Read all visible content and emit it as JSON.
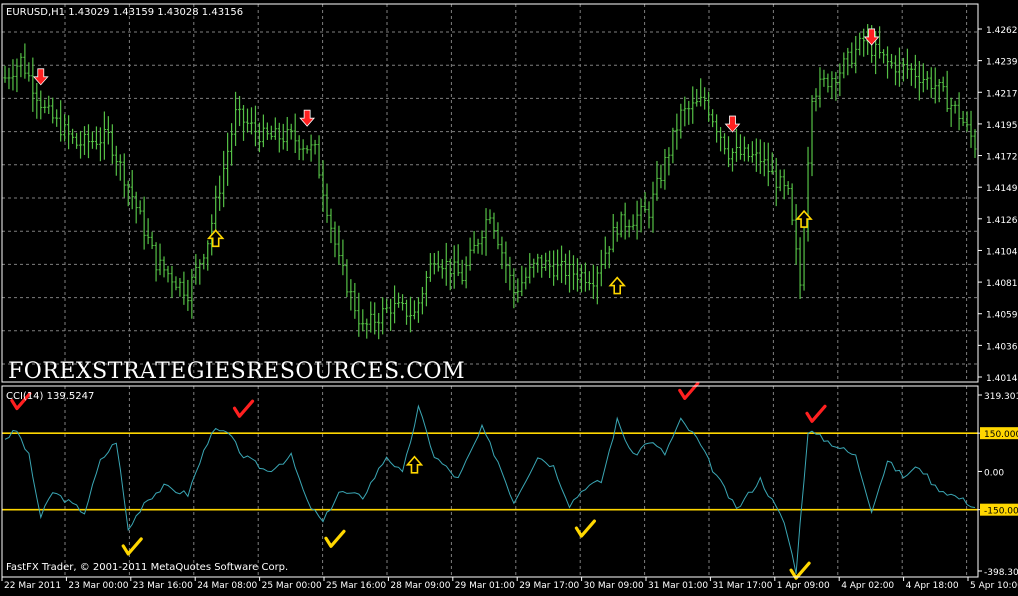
{
  "main_panel": {
    "header": "EURUSD,H1  1.43029 1.43159 1.43028 1.43156",
    "watermark": "FOREXSTRATEGIESRESOURCES.COM",
    "price_ticks": [
      "1.42620",
      "1.42399",
      "1.42170",
      "1.41950",
      "1.41720",
      "1.41490",
      "1.41260",
      "1.41040",
      "1.40815",
      "1.40590",
      "1.40365",
      "1.40140"
    ]
  },
  "indicator_panel": {
    "header": "CCI(14) 139.5247",
    "level_ticks": [
      "319.301",
      "150.000",
      "0.00",
      "-150.000",
      "-398.301"
    ]
  },
  "footer": {
    "copyright": "FastFX Trader, © 2001-2011 MetaQuotes Software Corp."
  },
  "time_axis": {
    "labels": [
      "22 Mar 2011",
      "23 Mar 00:00",
      "23 Mar 16:00",
      "24 Mar 08:00",
      "25 Mar 00:00",
      "25 Mar 16:00",
      "28 Mar 09:00",
      "29 Mar 01:00",
      "29 Mar 17:00",
      "30 Mar 09:00",
      "31 Mar 01:00",
      "31 Mar 17:00",
      "1 Apr 09:00",
      "4 Apr 02:00",
      "4 Apr 18:00",
      "5 Apr 10:00"
    ]
  },
  "colors": {
    "background": "#000000",
    "grid": "#7f7f7f",
    "bars": "#55c046",
    "cci_line": "#3aa6b4",
    "levels": "#ffd700",
    "sell_arrow": "#ff2020",
    "buy_arrow": "#ffd700",
    "frame": "#ffffff"
  },
  "chart_data": [
    {
      "type": "ohlc",
      "symbol": "EURUSD",
      "timeframe": "H1",
      "last_bar": {
        "open": 1.43029,
        "high": 1.43159,
        "low": 1.43028,
        "close": 1.43156
      },
      "ylim": [
        1.4014,
        1.427
      ],
      "grid": true,
      "waypoints": [
        {
          "bar": 0,
          "price": 1.422
        },
        {
          "bar": 4,
          "price": 1.4232
        },
        {
          "bar": 10,
          "price": 1.4198
        },
        {
          "bar": 18,
          "price": 1.4175
        },
        {
          "bar": 26,
          "price": 1.418
        },
        {
          "bar": 32,
          "price": 1.414
        },
        {
          "bar": 38,
          "price": 1.4095
        },
        {
          "bar": 46,
          "price": 1.4075
        },
        {
          "bar": 51,
          "price": 1.411
        },
        {
          "bar": 58,
          "price": 1.4195
        },
        {
          "bar": 65,
          "price": 1.418
        },
        {
          "bar": 72,
          "price": 1.418
        },
        {
          "bar": 78,
          "price": 1.417
        },
        {
          "bar": 84,
          "price": 1.4095
        },
        {
          "bar": 90,
          "price": 1.405
        },
        {
          "bar": 97,
          "price": 1.4065
        },
        {
          "bar": 103,
          "price": 1.406
        },
        {
          "bar": 108,
          "price": 1.41
        },
        {
          "bar": 115,
          "price": 1.4085
        },
        {
          "bar": 122,
          "price": 1.413
        },
        {
          "bar": 128,
          "price": 1.4075
        },
        {
          "bar": 134,
          "price": 1.4095
        },
        {
          "bar": 140,
          "price": 1.409
        },
        {
          "bar": 148,
          "price": 1.4085
        },
        {
          "bar": 154,
          "price": 1.412
        },
        {
          "bar": 162,
          "price": 1.413
        },
        {
          "bar": 170,
          "price": 1.4195
        },
        {
          "bar": 176,
          "price": 1.4205
        },
        {
          "bar": 182,
          "price": 1.417
        },
        {
          "bar": 190,
          "price": 1.4165
        },
        {
          "bar": 197,
          "price": 1.414
        },
        {
          "bar": 200,
          "price": 1.408
        },
        {
          "bar": 203,
          "price": 1.421
        },
        {
          "bar": 210,
          "price": 1.4225
        },
        {
          "bar": 216,
          "price": 1.4245
        },
        {
          "bar": 222,
          "price": 1.423
        },
        {
          "bar": 228,
          "price": 1.4225
        },
        {
          "bar": 234,
          "price": 1.4215
        },
        {
          "bar": 240,
          "price": 1.4195
        },
        {
          "bar": 244,
          "price": 1.4175
        }
      ]
    },
    {
      "type": "line",
      "name": "CCI(14)",
      "last_value": 139.5247,
      "ylim": [
        -398.301,
        319.301
      ],
      "levels": [
        150,
        -150
      ],
      "points": [
        {
          "bar": 0,
          "value": 130
        },
        {
          "bar": 3,
          "value": 160
        },
        {
          "bar": 6,
          "value": 60
        },
        {
          "bar": 9,
          "value": -180
        },
        {
          "bar": 12,
          "value": -80
        },
        {
          "bar": 16,
          "value": -120
        },
        {
          "bar": 20,
          "value": -160
        },
        {
          "bar": 24,
          "value": 40
        },
        {
          "bar": 28,
          "value": 120
        },
        {
          "bar": 31,
          "value": -230
        },
        {
          "bar": 35,
          "value": -120
        },
        {
          "bar": 40,
          "value": -60
        },
        {
          "bar": 46,
          "value": -90
        },
        {
          "bar": 52,
          "value": 160
        },
        {
          "bar": 56,
          "value": 150
        },
        {
          "bar": 60,
          "value": 60
        },
        {
          "bar": 66,
          "value": 0
        },
        {
          "bar": 72,
          "value": 60
        },
        {
          "bar": 76,
          "value": -120
        },
        {
          "bar": 80,
          "value": -200
        },
        {
          "bar": 84,
          "value": -80
        },
        {
          "bar": 90,
          "value": -100
        },
        {
          "bar": 96,
          "value": 60
        },
        {
          "bar": 100,
          "value": -10
        },
        {
          "bar": 104,
          "value": 250
        },
        {
          "bar": 108,
          "value": 60
        },
        {
          "bar": 114,
          "value": -30
        },
        {
          "bar": 120,
          "value": 170
        },
        {
          "bar": 124,
          "value": 40
        },
        {
          "bar": 128,
          "value": -120
        },
        {
          "bar": 134,
          "value": 60
        },
        {
          "bar": 138,
          "value": 20
        },
        {
          "bar": 142,
          "value": -130
        },
        {
          "bar": 146,
          "value": -60
        },
        {
          "bar": 150,
          "value": -40
        },
        {
          "bar": 154,
          "value": 200
        },
        {
          "bar": 158,
          "value": 60
        },
        {
          "bar": 162,
          "value": 120
        },
        {
          "bar": 166,
          "value": 70
        },
        {
          "bar": 170,
          "value": 200
        },
        {
          "bar": 174,
          "value": 130
        },
        {
          "bar": 178,
          "value": 10
        },
        {
          "bar": 184,
          "value": -150
        },
        {
          "bar": 190,
          "value": -30
        },
        {
          "bar": 196,
          "value": -200
        },
        {
          "bar": 199,
          "value": -390
        },
        {
          "bar": 202,
          "value": 160
        },
        {
          "bar": 208,
          "value": 110
        },
        {
          "bar": 214,
          "value": 60
        },
        {
          "bar": 218,
          "value": -150
        },
        {
          "bar": 222,
          "value": 40
        },
        {
          "bar": 226,
          "value": -20
        },
        {
          "bar": 230,
          "value": 20
        },
        {
          "bar": 234,
          "value": -60
        },
        {
          "bar": 238,
          "value": -90
        },
        {
          "bar": 242,
          "value": -120
        },
        {
          "bar": 244,
          "value": -140
        }
      ]
    }
  ],
  "signals": {
    "sell_arrows": [
      {
        "bar": 9,
        "price": 1.422
      },
      {
        "bar": 76,
        "price": 1.4192
      },
      {
        "bar": 183,
        "price": 1.4188
      },
      {
        "bar": 218,
        "price": 1.4247
      }
    ],
    "buy_arrows": [
      {
        "bar": 53,
        "price": 1.4112
      },
      {
        "bar": 154,
        "price": 1.408
      },
      {
        "bar": 201,
        "price": 1.4125
      }
    ],
    "buy_arrows_cci": [
      {
        "bar": 103,
        "value": 30
      }
    ],
    "red_checks_cci": [
      {
        "bar": 4,
        "value": 270
      },
      {
        "bar": 60,
        "value": 240
      },
      {
        "bar": 172,
        "value": 310
      },
      {
        "bar": 204,
        "value": 220
      }
    ],
    "yellow_checks_cci": [
      {
        "bar": 32,
        "value": -300
      },
      {
        "bar": 83,
        "value": -270
      },
      {
        "bar": 146,
        "value": -230
      },
      {
        "bar": 200,
        "value": -395
      }
    ]
  }
}
